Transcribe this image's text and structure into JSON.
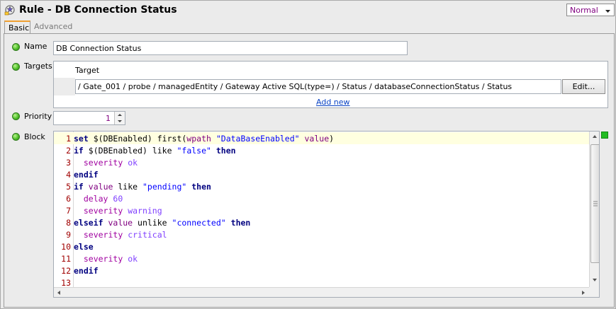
{
  "window": {
    "title": "Rule - DB Connection Status",
    "mode_select": "Normal"
  },
  "tabs": [
    {
      "label": "Basic",
      "active": true
    },
    {
      "label": "Advanced",
      "active": false
    }
  ],
  "fields": {
    "name_label": "Name",
    "name_value": "DB Connection Status",
    "targets_label": "Targets",
    "targets_header": "Target",
    "target_path": "/ Gate_001 / probe / managedEntity / Gateway Active SQL(type=) / Status / databaseConnectionStatus / Status",
    "edit_button": "Edit...",
    "add_new_link": "Add new",
    "priority_label": "Priority",
    "priority_value": "1",
    "block_label": "Block"
  },
  "code_lines": [
    {
      "n": "1",
      "text": "set $(DBEnabled) first(wpath \"DataBaseEnabled\" value)"
    },
    {
      "n": "2",
      "text": "if $(DBEnabled) like \"false\" then"
    },
    {
      "n": "3",
      "text": "  severity ok"
    },
    {
      "n": "4",
      "text": "endif"
    },
    {
      "n": "5",
      "text": "if value like \"pending\" then"
    },
    {
      "n": "6",
      "text": "  delay 60"
    },
    {
      "n": "7",
      "text": "  severity warning"
    },
    {
      "n": "8",
      "text": "elseif value unlike \"connected\" then"
    },
    {
      "n": "9",
      "text": "  severity critical"
    },
    {
      "n": "10",
      "text": "else"
    },
    {
      "n": "11",
      "text": "  severity ok"
    },
    {
      "n": "12",
      "text": "endif"
    },
    {
      "n": "13",
      "text": ""
    }
  ],
  "colors": {
    "status_ok": "#4fbf2a",
    "keyword": "#000080",
    "string": "#0000ff",
    "line_number": "#a00000",
    "active_line_bg": "#ffffe0"
  }
}
